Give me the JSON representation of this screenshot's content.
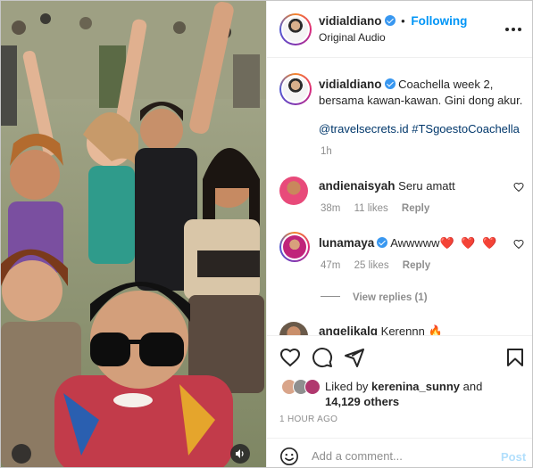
{
  "header": {
    "username": "vidialdiano",
    "separator": "•",
    "follow_status": "Following",
    "audio": "Original Audio"
  },
  "caption": {
    "username": "vidialdiano",
    "text": "Coachella week 2, bersama kawan-kawan. Gini dong akur.",
    "hashtags": "@travelsecrets.id #TSgoestoCoachella",
    "time": "1h"
  },
  "comments": [
    {
      "username": "andienaisyah",
      "verified": false,
      "text": "Seru amatt",
      "time": "38m",
      "likes": "11 likes",
      "reply": "Reply"
    },
    {
      "username": "lunamaya",
      "verified": true,
      "text": "Awwwww",
      "emoji": "❤️ ❤️ ❤️",
      "time": "47m",
      "likes": "25 likes",
      "reply": "Reply",
      "view_replies": "View replies (1)"
    },
    {
      "username": "angelikalg",
      "verified": false,
      "text": "Kerennn",
      "emoji": "🔥"
    }
  ],
  "likes": {
    "prefix": "Liked by",
    "user": "kerenina_sunny",
    "and": "and",
    "others": "14,129 others"
  },
  "timestamp": "1 HOUR AGO",
  "add_comment": {
    "placeholder": "Add a comment...",
    "post_label": "Post"
  },
  "colors": {
    "accent": "#0095f6",
    "verified": "#3897f0",
    "heart": "#ed4956",
    "muted": "#8e8e8e",
    "post_disabled": "#b2dffc"
  },
  "icons": {
    "like": "heart-outline-icon",
    "comment": "speech-bubble-icon",
    "share": "paper-plane-icon",
    "save": "bookmark-icon",
    "more": "ellipsis-icon",
    "emoji": "smiley-icon",
    "sound": "speaker-icon"
  }
}
